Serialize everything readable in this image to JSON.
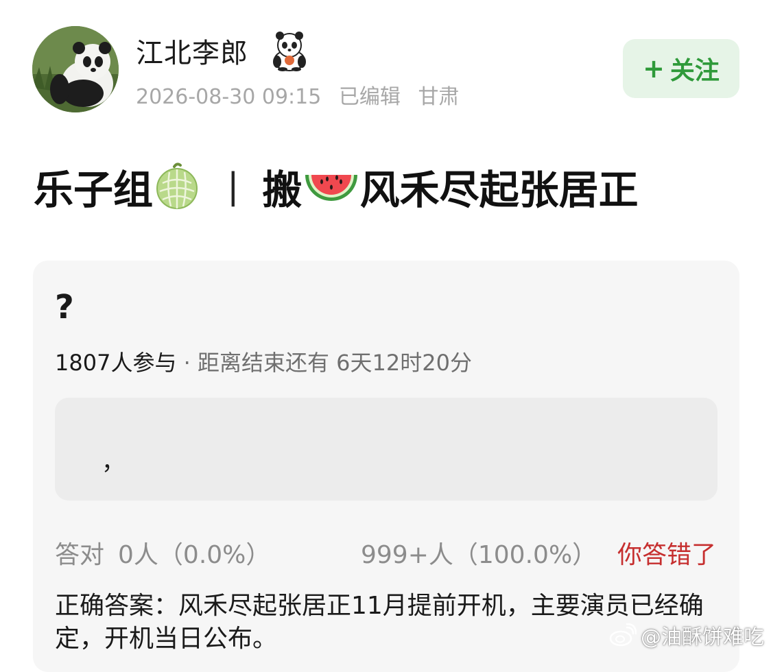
{
  "author": {
    "name": "江北李郎",
    "avatar_icon": "panda-avatar",
    "badge_icon": "panda-badge-icon",
    "timestamp": "2026-08-30 09:15",
    "edited": "已编辑",
    "location": "甘肃",
    "follow_plus": "+",
    "follow_label": "关注"
  },
  "post": {
    "title_part1": "乐子组",
    "title_emoji1": "melon-icon",
    "title_separator": "|",
    "title_part2": "搬",
    "title_emoji2": "watermelon-icon",
    "title_part3": "风禾尽起张居正"
  },
  "quiz": {
    "question": "?",
    "participants": "1807人参与",
    "dot": " · ",
    "time_left": "距离结束还有 6天12时20分",
    "option_text": "，",
    "correct_label": "答对",
    "correct_count": "0人（0.0%）",
    "wrong_count": "999+人（100.0%）",
    "result": "你答错了",
    "answer": "正确答案：风禾尽起张居正11月提前开机，主要演员已经确定，开机当日公布。"
  },
  "watermark": {
    "icon": "weibo-icon",
    "text": "@油酥饼难吃"
  },
  "colors": {
    "follow_bg": "#e6f4e7",
    "follow_text": "#2f9a3a",
    "wrong_text": "#c62f2f",
    "card_bg": "#f6f6f6",
    "option_bg": "#ececec"
  }
}
